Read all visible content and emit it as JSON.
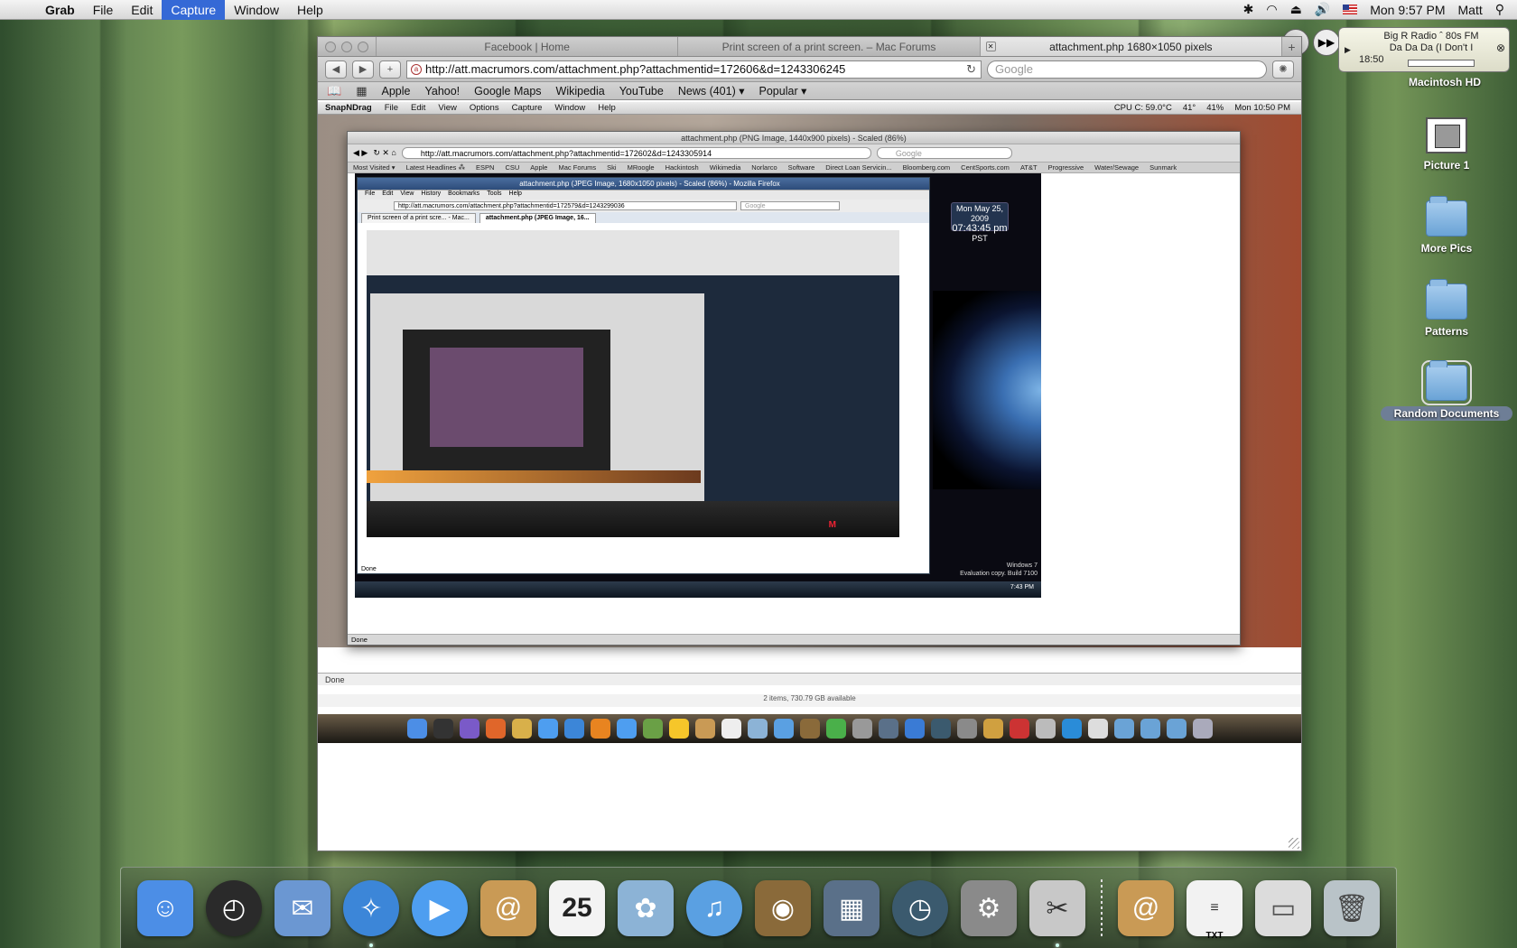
{
  "menubar": {
    "app": "Grab",
    "items": [
      "File",
      "Edit",
      "Capture",
      "Window",
      "Help"
    ],
    "active_item": "Capture",
    "clock": "Mon 9:57 PM",
    "user": "Matt"
  },
  "radio": {
    "station": "Big R Radio ˆ 80s FM",
    "track": "Da Da Da (I Don't I",
    "time": "18:50"
  },
  "desktop": {
    "disk": "Macintosh HD",
    "icons": [
      {
        "label": "Picture 1",
        "icon": "picture-file-icon"
      },
      {
        "label": "More Pics",
        "icon": "folder-icon"
      },
      {
        "label": "Patterns",
        "icon": "folder-icon"
      },
      {
        "label": "Random Documents",
        "icon": "folder-icon"
      }
    ]
  },
  "safari": {
    "tabs": [
      {
        "label": "Facebook | Home"
      },
      {
        "label": "Print screen of a print screen. – Mac Forums"
      },
      {
        "label": "attachment.php 1680×1050 pixels",
        "active": true
      }
    ],
    "url": "http://att.macrumors.com/attachment.php?attachmentid=172606&d=1243306245",
    "search_placeholder": "Google",
    "bookmarks": [
      "Apple",
      "Yahoo!",
      "Google Maps",
      "Wikipedia",
      "YouTube",
      "News (401) ▾",
      "Popular ▾"
    ]
  },
  "inner_shot": {
    "app": "SnapNDrag",
    "menu": [
      "File",
      "Edit",
      "View",
      "Options",
      "Capture",
      "Window",
      "Help"
    ],
    "status_right": [
      "CPU C: 59.0°C",
      "41°",
      "41%",
      "Mon 10:50 PM"
    ],
    "firefox_title": "attachment.php (PNG Image, 1440x900 pixels) - Scaled (86%)",
    "firefox_url": "http://att.macrumors.com/attachment.php?attachmentid=172602&d=1243305914",
    "firefox_search": "Google",
    "firefox_bookmarks": [
      "Most Visited ▾",
      "Latest Headlines ⁂",
      "ESPN",
      "CSU",
      "Apple",
      "Mac Forums",
      "Ski",
      "MRoogle",
      "Hackintosh",
      "Wikimedia",
      "Norlarco",
      "Software",
      "Direct Loan Servicin...",
      "Bloomberg.com",
      "CentSports.com",
      "AT&T",
      "Progressive",
      "Water/Sewage",
      "Sunmark"
    ],
    "firefox_status": "Done",
    "win7": {
      "window_title": "attachment.php (JPEG Image, 1680x1050 pixels) - Scaled (86%) - Mozilla Firefox",
      "menu": [
        "File",
        "Edit",
        "View",
        "History",
        "Bookmarks",
        "Tools",
        "Help"
      ],
      "url": "http://att.macrumors.com/attachment.php?attachmentid=172579&d=1243299036",
      "search": "Google",
      "tabs": [
        "Print screen of a print scre... - Mac...",
        "attachment.php (JPEG Image, 16..."
      ],
      "clock_date": "Mon May 25, 2009",
      "clock_time": "07:43:45 pm",
      "clock_tz": "PST",
      "watermark_line1": "Windows 7",
      "watermark_line2": "Evaluation copy. Build 7100",
      "taskbar_time": "7:43 PM",
      "status": "Done"
    },
    "items_line": "2 items, 730.79 GB available",
    "outer_status": "Done"
  },
  "dock": {
    "items": [
      {
        "icon": "finder-icon",
        "color": "#4c8ee6"
      },
      {
        "icon": "dashboard-icon",
        "color": "#2a2a2a"
      },
      {
        "icon": "mail-icon",
        "color": "#6b97d2"
      },
      {
        "icon": "safari-icon",
        "color": "#3c86d8",
        "running": true
      },
      {
        "icon": "ichat-icon",
        "color": "#4e9ef0"
      },
      {
        "icon": "address-book-icon",
        "color": "#c99a55"
      },
      {
        "icon": "ical-icon",
        "color": "#f3f3f3"
      },
      {
        "icon": "iphoto-icon",
        "color": "#8cb3d6"
      },
      {
        "icon": "itunes-icon",
        "color": "#5aa0e2"
      },
      {
        "icon": "photo-booth-icon",
        "color": "#8a6a3a"
      },
      {
        "icon": "spaces-icon",
        "color": "#5a7089"
      },
      {
        "icon": "time-machine-icon",
        "color": "#3b5a6e"
      },
      {
        "icon": "system-preferences-icon",
        "color": "#8a8a8a"
      },
      {
        "icon": "grab-icon",
        "color": "#c8c8c8",
        "running": true
      },
      {
        "icon": "address-book-doc-icon",
        "color": "#c99a55"
      },
      {
        "icon": "txt-file-icon",
        "color": "#f2f2f2",
        "label": "TXT"
      },
      {
        "icon": "disk-image-icon",
        "color": "#dcdcdc"
      },
      {
        "icon": "trash-icon",
        "color": "#b9c3c8"
      }
    ]
  }
}
